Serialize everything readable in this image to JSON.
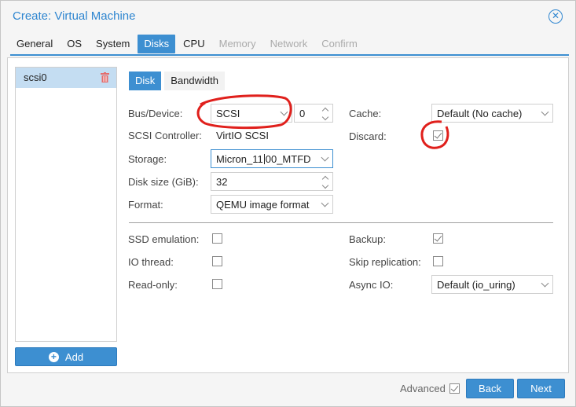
{
  "window": {
    "title": "Create: Virtual Machine"
  },
  "tabs": [
    {
      "label": "General",
      "state": "normal"
    },
    {
      "label": "OS",
      "state": "normal"
    },
    {
      "label": "System",
      "state": "normal"
    },
    {
      "label": "Disks",
      "state": "active"
    },
    {
      "label": "CPU",
      "state": "normal"
    },
    {
      "label": "Memory",
      "state": "disabled"
    },
    {
      "label": "Network",
      "state": "disabled"
    },
    {
      "label": "Confirm",
      "state": "disabled"
    }
  ],
  "disk_list": {
    "items": [
      {
        "label": "scsi0"
      }
    ],
    "add_label": "Add"
  },
  "subtabs": [
    {
      "label": "Disk",
      "state": "active"
    },
    {
      "label": "Bandwidth",
      "state": "normal"
    }
  ],
  "form": {
    "bus_device": {
      "label": "Bus/Device:",
      "bus": "SCSI",
      "device": "0"
    },
    "scsi_controller": {
      "label": "SCSI Controller:",
      "value": "VirtIO SCSI"
    },
    "storage": {
      "label": "Storage:",
      "value_before_cursor": "Micron_11",
      "value_after_cursor": "00_MTFD"
    },
    "disk_size": {
      "label": "Disk size (GiB):",
      "value": "32"
    },
    "format": {
      "label": "Format:",
      "value": "QEMU image format"
    },
    "cache": {
      "label": "Cache:",
      "value": "Default (No cache)"
    },
    "discard": {
      "label": "Discard:",
      "checked": true
    },
    "ssd_emulation": {
      "label": "SSD emulation:",
      "checked": false
    },
    "io_thread": {
      "label": "IO thread:",
      "checked": false
    },
    "read_only": {
      "label": "Read-only:",
      "checked": false
    },
    "backup": {
      "label": "Backup:",
      "checked": true
    },
    "skip_replication": {
      "label": "Skip replication:",
      "checked": false
    },
    "async_io": {
      "label": "Async IO:",
      "value": "Default (io_uring)"
    }
  },
  "footer": {
    "advanced_label": "Advanced",
    "advanced_checked": true,
    "back_label": "Back",
    "next_label": "Next"
  },
  "colors": {
    "accent": "#3d8fd1",
    "title": "#2f86d0",
    "annotation": "#e0201c",
    "trash": "#e46d6d"
  }
}
